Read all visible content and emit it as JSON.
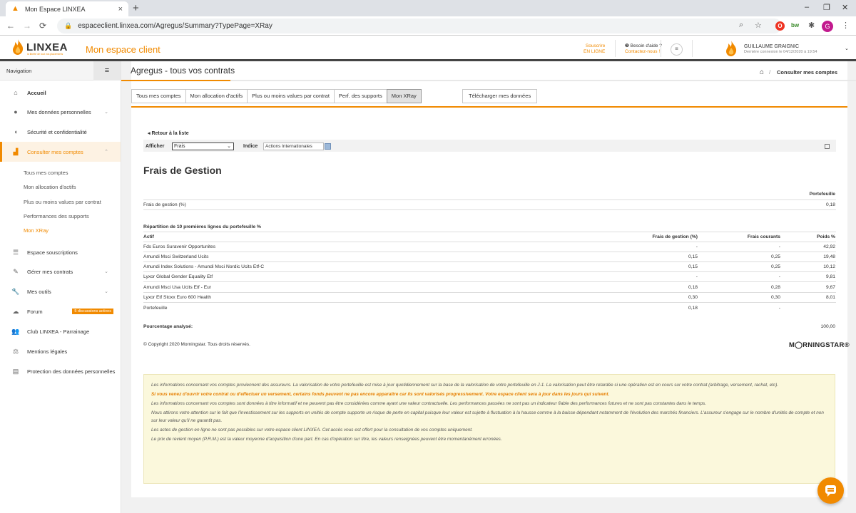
{
  "browser": {
    "tab_title": "Mon Espace LINXEA",
    "tab_close": "×",
    "new_tab": "+",
    "url": "espaceclient.linxea.com/Agregus/Summary?TypePage=XRay",
    "ext_red": "O",
    "ext_bw": "bw",
    "profile_initial": "G",
    "win_min": "–",
    "win_max": "❐",
    "win_close": "✕"
  },
  "header": {
    "logo_text": "LINXEA",
    "logo_tagline": "la liberté de tout vos placements",
    "site_title": "Mon espace client",
    "subscribe_line1": "Souscrire",
    "subscribe_line2": "EN LIGNE",
    "help_line1": "❷ Besoin d'aide ?",
    "help_line2": "Contactez-nous !",
    "user_name": "GUILLAUME GRAIGNIC",
    "user_last_login": "Dernière connexion le 04/12/2020 à 19:54"
  },
  "sidebar": {
    "heading": "Navigation",
    "items": [
      {
        "label": "Accueil",
        "bold": true
      },
      {
        "label": "Mes données personnelles"
      },
      {
        "label": "Sécurité et confidentialité"
      },
      {
        "label": "Consulter mes comptes"
      },
      {
        "label": "Espace souscriptions"
      },
      {
        "label": "Gérer mes contrats"
      },
      {
        "label": "Mes outils"
      },
      {
        "label": "Forum"
      },
      {
        "label": "Club LINXEA - Parrainage"
      },
      {
        "label": "Mentions légales"
      },
      {
        "label": "Protection des données personnelles"
      }
    ],
    "sub_items": [
      {
        "label": "Tous mes comptes"
      },
      {
        "label": "Mon allocation d'actifs"
      },
      {
        "label": "Plus ou moins values par contrat"
      },
      {
        "label": "Performances des supports"
      },
      {
        "label": "Mon XRay"
      }
    ],
    "forum_badge": "5 discussions actives"
  },
  "page": {
    "heading": "Agregus - tous vos contrats",
    "breadcrumb": "Consulter mes comptes",
    "tabs": [
      {
        "label": "Tous mes comptes"
      },
      {
        "label": "Mon allocation d'actifs"
      },
      {
        "label": "Plus ou moins values par contrat"
      },
      {
        "label": "Perf. des supports"
      },
      {
        "label": "Mon XRay"
      }
    ],
    "download_label": "Télécharger mes données",
    "back_link": "◂ Retour à la liste",
    "filter": {
      "show_label": "Afficher",
      "show_value": "Frais",
      "index_label": "Indice",
      "index_value": "Actions Internationales"
    },
    "xray_title": "Frais de Gestion",
    "summary": {
      "col_header": "Portefeuille",
      "row_label": "Frais de gestion (%)",
      "row_value": "0,18"
    },
    "breakdown": {
      "section_title": "Répartition de 10 premières lignes du portefeuille %",
      "headers": {
        "asset": "Actif",
        "mgmt": "Frais de gestion (%)",
        "current": "Frais courants",
        "weight": "Poids %"
      },
      "rows": [
        {
          "asset": "Fds Euros Suravenir Opportunites",
          "mgmt": "-",
          "current": "-",
          "weight": "42,92"
        },
        {
          "asset": "Amundi Msci Switzerland Ucits",
          "mgmt": "0,15",
          "current": "0,25",
          "weight": "19,48"
        },
        {
          "asset": "Amundi Index Solutions - Amundi Msci Nordic Ucits Etf-C",
          "mgmt": "0,15",
          "current": "0,25",
          "weight": "10,12"
        },
        {
          "asset": "Lyxor Global Gender Equality Etf",
          "mgmt": "-",
          "current": "-",
          "weight": "9,81"
        },
        {
          "asset": "Amundi Msci Usa Ucits Etf - Eur",
          "mgmt": "0,18",
          "current": "0,28",
          "weight": "9,67"
        },
        {
          "asset": "Lyxor Etf Stoxx Euro 600 Health",
          "mgmt": "0,30",
          "current": "0,30",
          "weight": "8,01"
        },
        {
          "asset": "Portefeuille",
          "mgmt": "0,18",
          "current": "-",
          "weight": ""
        }
      ],
      "analysed_label": "Pourcentage analysé:",
      "analysed_value": "100,00"
    },
    "copyright": "© Copyright 2020 Morningstar. Tous droits réservés.",
    "morningstar": "M◯RNINGSTAR®",
    "info": [
      "Les informations concernant vos comptes proviennent des assureurs. La valorisation de votre portefeuille est mise à jour quotidiennement sur la base de la valorisation de votre portefeuille en J-1. La valorisation peut être retardée si une opération est en cours sur votre contrat (arbitrage, versement, rachat, etc).",
      "Si vous venez d'ouvrir votre contrat ou d'effectuer un versement, certains fonds peuvent ne pas encore apparaître car ils sont valorisés progressivement. Votre espace client sera à jour dans les jours qui suivent.",
      "Les informations concernant vos comptes sont données à titre informatif et ne peuvent pas être considérées comme ayant une valeur contractuelle. Les performances passées ne sont pas un indicateur fiable des performances futures et ne sont pas constantes dans le temps.",
      "Nous attirons votre attention sur le fait que l'investissement sur les supports en unités de compte supporte un risque de perte en capital puisque leur valeur est sujette à fluctuation à la hausse comme à la baisse dépendant notamment de l'évolution des marchés financiers. L'assureur s'engage sur le nombre d'unités de compte et non sur leur valeur qu'il ne garantit pas.",
      "Les actes de gestion en ligne ne sont pas possibles sur votre espace client LINXEA. Cet accès vous est offert pour la consultation de vos comptes uniquement.",
      "Le prix de revient moyen (P.R.M.) est la valeur moyenne d'acquisition d'une part. En cas d'opération sur titre, les valeurs renseignées peuvent être momentanément erronées."
    ]
  },
  "colors": {
    "accent": "#f18a00",
    "info_bg": "#fbf8dc"
  }
}
